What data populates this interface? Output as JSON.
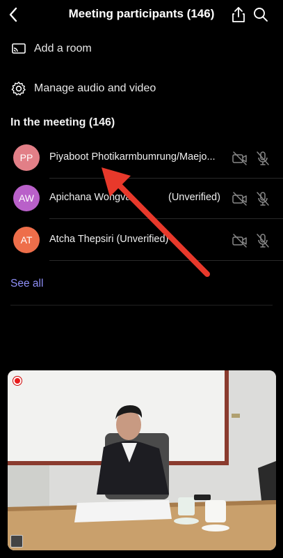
{
  "header": {
    "title": "Meeting participants (146)"
  },
  "menu": {
    "add_room": "Add a room",
    "manage_av": "Manage audio and video"
  },
  "section": {
    "title": "In the meeting (146)"
  },
  "participants": [
    {
      "initials": "PP",
      "name": "Piyaboot Photikarmbumrung/Maejo...",
      "status": "",
      "color": "#e27f87"
    },
    {
      "initials": "AW",
      "name": "Apichana Wongva",
      "status": "(Unverified)",
      "color": "#b960c9"
    },
    {
      "initials": "AT",
      "name": "Atcha Thepsiri (Unverified)",
      "status": "",
      "color": "#ee6e4a"
    }
  ],
  "see_all": "See all",
  "colors": {
    "accent_link": "#8f8ff7",
    "arrow": "#e8392b",
    "background": "#000000"
  },
  "icons": [
    "back-icon",
    "share-icon",
    "search-icon",
    "cast-icon",
    "gear-icon",
    "video-off-icon",
    "mic-off-icon",
    "recording-icon"
  ]
}
